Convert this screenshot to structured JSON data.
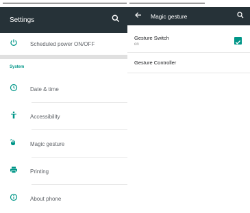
{
  "left": {
    "title": "Settings",
    "scheduled_label": "Scheduled power ON/OFF",
    "section_system": "System",
    "items": [
      {
        "label": "Date & time",
        "icon": "clock-icon"
      },
      {
        "label": "Accessibility",
        "icon": "accessibility-icon"
      },
      {
        "label": "Magic gesture",
        "icon": "hand-gesture-icon"
      },
      {
        "label": "Printing",
        "icon": "printer-icon"
      },
      {
        "label": "About phone",
        "icon": "info-icon"
      }
    ]
  },
  "right": {
    "title": "Magic gesture",
    "gesture_switch": {
      "label": "Gesture Switch",
      "sub": "on",
      "checked": true
    },
    "gesture_controller": "Gesture Controller"
  },
  "colors": {
    "appbar": "#263238",
    "accent": "#009688"
  }
}
